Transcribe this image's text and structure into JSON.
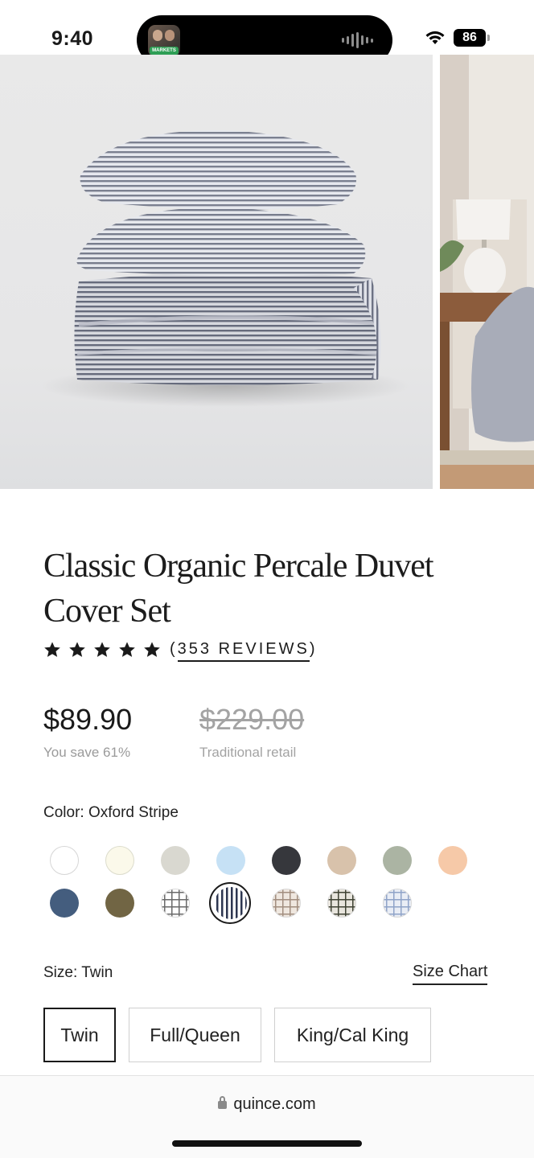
{
  "status_bar": {
    "time": "9:40",
    "island_app_tag": "MARKETS",
    "battery": "86"
  },
  "product": {
    "title": "Classic Organic Percale Duvet Cover Set",
    "rating_stars": 5,
    "reviews_text": "353 REVIEWS",
    "price": "$89.90",
    "savings": "You save 61%",
    "retail_price": "$229.00",
    "retail_label": "Traditional retail"
  },
  "color": {
    "label": "Color:",
    "selected": "Oxford Stripe",
    "swatches": [
      {
        "pattern": "solid",
        "color": "#ffffff",
        "border": "#d6d6d6"
      },
      {
        "pattern": "solid",
        "color": "#fbf9ea",
        "border": "#dcdccc"
      },
      {
        "pattern": "solid",
        "color": "#d9d8d0"
      },
      {
        "pattern": "solid",
        "color": "#c6e1f5"
      },
      {
        "pattern": "solid",
        "color": "#36373c"
      },
      {
        "pattern": "solid",
        "color": "#d8c2ab"
      },
      {
        "pattern": "solid",
        "color": "#abb4a3"
      },
      {
        "pattern": "solid",
        "color": "#f6c9a8"
      },
      {
        "pattern": "solid",
        "color": "#445d7e"
      },
      {
        "pattern": "solid",
        "color": "#716544"
      },
      {
        "pattern": "grid",
        "color": "#ffffff",
        "line": "#6a6a6a"
      },
      {
        "pattern": "stripe",
        "color": "#ffffff",
        "line": "#2d3650",
        "selected": true
      },
      {
        "pattern": "grid",
        "color": "#efe7df",
        "line": "#a28e7f"
      },
      {
        "pattern": "grid",
        "color": "#e8e5dd",
        "line": "#3f4234"
      },
      {
        "pattern": "grid",
        "color": "#e9edf5",
        "line": "#8fa3c8"
      }
    ]
  },
  "size": {
    "label": "Size:",
    "selected": "Twin",
    "chart_link": "Size Chart",
    "options": [
      "Twin",
      "Full/Queen",
      "King/Cal King"
    ]
  },
  "browser": {
    "url": "quince.com"
  }
}
